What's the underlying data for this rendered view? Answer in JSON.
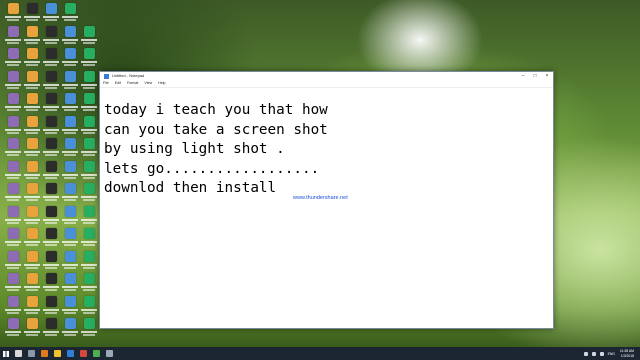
{
  "window": {
    "title": "Untitled - Notepad",
    "minimize_glyph": "–",
    "maximize_glyph": "□",
    "close_glyph": "×"
  },
  "menu": [
    "File",
    "Edit",
    "Format",
    "View",
    "Help"
  ],
  "editor": {
    "lines": [
      "today i teach you that how",
      "can you take a screen shot",
      "by using light shot .",
      "lets go..................",
      "downlod then install"
    ]
  },
  "overlay_link": "www.thundershare.net",
  "taskbar": {
    "language": "ENG",
    "clock_time": "11:38 AM",
    "clock_date": "1/3/2018"
  },
  "colors": {
    "accent": "#1a4fd8",
    "taskbar": "#1c2633"
  }
}
